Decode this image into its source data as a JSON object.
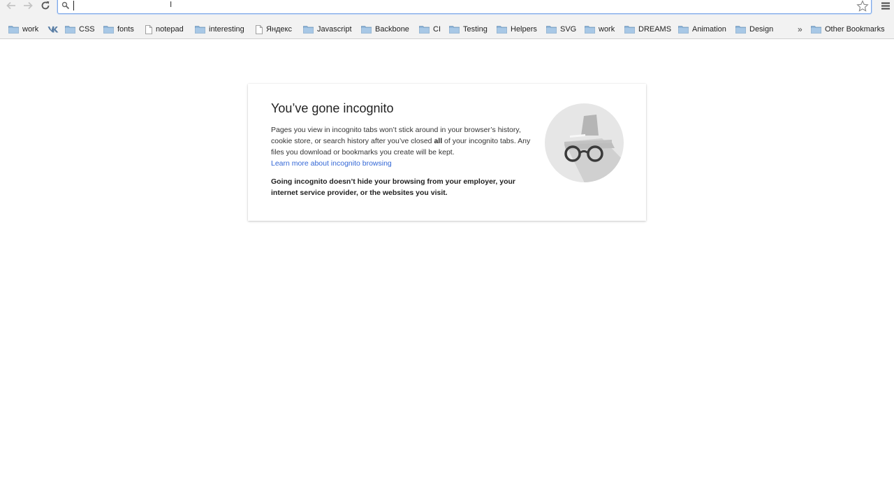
{
  "toolbar": {
    "back_icon": "arrow-left-icon",
    "forward_icon": "arrow-right-icon",
    "reload_icon": "reload-icon",
    "omnibox": {
      "value": "",
      "search_icon": "search-icon",
      "star_icon": "star-icon"
    },
    "menu_icon": "hamburger-menu-icon"
  },
  "bookmarks": {
    "items": [
      {
        "label": "work",
        "type": "folder"
      },
      {
        "label": "",
        "type": "vk"
      },
      {
        "label": "CSS",
        "type": "folder"
      },
      {
        "label": "fonts",
        "type": "folder"
      },
      {
        "label": "notepad",
        "type": "page"
      },
      {
        "label": "interesting",
        "type": "folder"
      },
      {
        "label": "Яндекс",
        "type": "page"
      },
      {
        "label": "Javascript",
        "type": "folder"
      },
      {
        "label": "Backbone",
        "type": "folder"
      },
      {
        "label": "CI",
        "type": "folder"
      },
      {
        "label": "Testing",
        "type": "folder"
      },
      {
        "label": "Helpers",
        "type": "folder"
      },
      {
        "label": "SVG",
        "type": "folder"
      },
      {
        "label": "work",
        "type": "folder"
      },
      {
        "label": "DREAMS",
        "type": "folder"
      },
      {
        "label": "Animation",
        "type": "folder"
      },
      {
        "label": "Design",
        "type": "folder"
      }
    ],
    "overflow": "»",
    "other": "Other Bookmarks"
  },
  "incognito": {
    "title": "You’ve gone incognito",
    "p1_before": "Pages you view in incognito tabs won’t stick around in your browser’s history, cookie store, or search history after you’ve closed ",
    "p1_bold": "all",
    "p1_after": " of your incognito tabs. Any files you download or bookmarks you create will be kept.",
    "learn_more": "Learn more about incognito browsing",
    "warning": "Going incognito doesn’t hide your browsing from your employer, your internet service provider, or the websites you visit.",
    "illustration_icon": "incognito-spy-icon"
  },
  "colors": {
    "link": "#3367d6",
    "omnibox_focus": "#7ea8e8",
    "folder": "#8fb6d9"
  }
}
